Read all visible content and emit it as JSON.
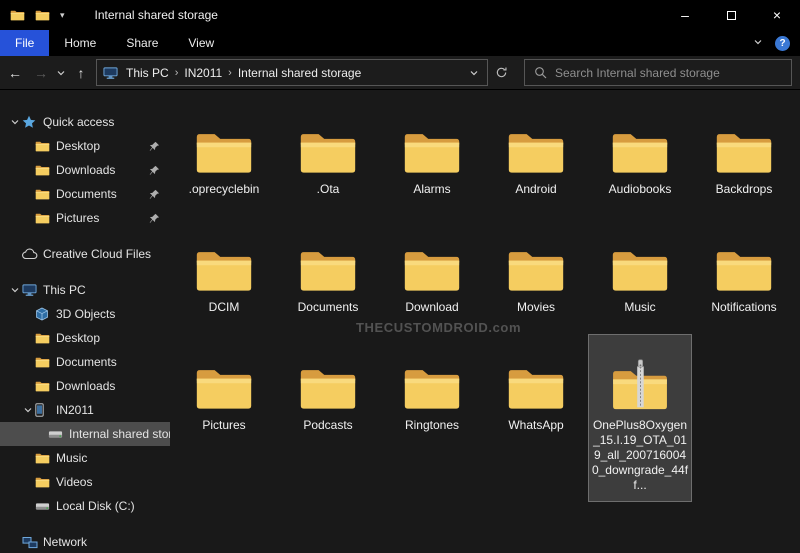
{
  "colors": {
    "accent": "#2652d9",
    "folder_back": "#d79c3f",
    "folder_front": "#f5cd60",
    "folder_highlight": "#fbe291",
    "selection_bg": "#3d3d3d",
    "sidebar_selection": "#4d4d4d"
  },
  "icons": {
    "help": "?",
    "minimize": "–",
    "close": "×",
    "qat_dropdown": "▾",
    "breadcrumb_separator": "›",
    "back_arrow": "←",
    "forward_arrow": "→",
    "up_arrow": "↑"
  },
  "titlebar": {
    "title": "Internal shared storage"
  },
  "ribbon": {
    "tabs": [
      {
        "label": "File",
        "active": true
      },
      {
        "label": "Home",
        "active": false
      },
      {
        "label": "Share",
        "active": false
      },
      {
        "label": "View",
        "active": false
      }
    ]
  },
  "address": {
    "breadcrumbs": [
      "This PC",
      "IN2011",
      "Internal shared storage"
    ]
  },
  "search": {
    "placeholder": "Search Internal shared storage"
  },
  "sidebar": {
    "items": [
      {
        "label": "Quick access",
        "icon": "star",
        "indent": 0,
        "chevron": "down"
      },
      {
        "label": "Desktop",
        "icon": "desktop",
        "indent": 1,
        "pinned": true
      },
      {
        "label": "Downloads",
        "icon": "downloads",
        "indent": 1,
        "pinned": true
      },
      {
        "label": "Documents",
        "icon": "documents",
        "indent": 1,
        "pinned": true
      },
      {
        "label": "Pictures",
        "icon": "pictures",
        "indent": 1,
        "pinned": true
      },
      {
        "label": "Creative Cloud Files",
        "icon": "cloud",
        "indent": 0,
        "gapBefore": true
      },
      {
        "label": "This PC",
        "icon": "this-pc",
        "indent": 0,
        "chevron": "down",
        "gapBefore": true
      },
      {
        "label": "3D Objects",
        "icon": "cube",
        "indent": 1
      },
      {
        "label": "Desktop",
        "icon": "desktop",
        "indent": 1
      },
      {
        "label": "Documents",
        "icon": "documents",
        "indent": 1
      },
      {
        "label": "Downloads",
        "icon": "downloads",
        "indent": 1
      },
      {
        "label": "IN2011",
        "icon": "phone",
        "indent": 1,
        "chevron": "down"
      },
      {
        "label": "Internal shared storage",
        "icon": "internal-storage",
        "indent": 2,
        "selected": true
      },
      {
        "label": "Music",
        "icon": "music",
        "indent": 1
      },
      {
        "label": "Videos",
        "icon": "videos",
        "indent": 1
      },
      {
        "label": "Local Disk (C:)",
        "icon": "disk",
        "indent": 1
      },
      {
        "label": "Network",
        "icon": "network",
        "indent": 0,
        "gapBefore": true
      }
    ]
  },
  "content": {
    "watermark": "THECUSTOMDROID.com",
    "items": [
      {
        "label": ".oprecyclebin",
        "type": "folder"
      },
      {
        "label": ".Ota",
        "type": "folder"
      },
      {
        "label": "Alarms",
        "type": "folder"
      },
      {
        "label": "Android",
        "type": "folder"
      },
      {
        "label": "Audiobooks",
        "type": "folder"
      },
      {
        "label": "Backdrops",
        "type": "folder"
      },
      {
        "label": "DCIM",
        "type": "folder"
      },
      {
        "label": "Documents",
        "type": "folder"
      },
      {
        "label": "Download",
        "type": "folder"
      },
      {
        "label": "Movies",
        "type": "folder"
      },
      {
        "label": "Music",
        "type": "folder"
      },
      {
        "label": "Notifications",
        "type": "folder"
      },
      {
        "label": "Pictures",
        "type": "folder"
      },
      {
        "label": "Podcasts",
        "type": "folder"
      },
      {
        "label": "Ringtones",
        "type": "folder"
      },
      {
        "label": "WhatsApp",
        "type": "folder"
      },
      {
        "label": "OnePlus8Oxygen_15.I.19_OTA_019_all_2007160040_downgrade_44ff...",
        "type": "zip",
        "selected": true
      }
    ]
  }
}
